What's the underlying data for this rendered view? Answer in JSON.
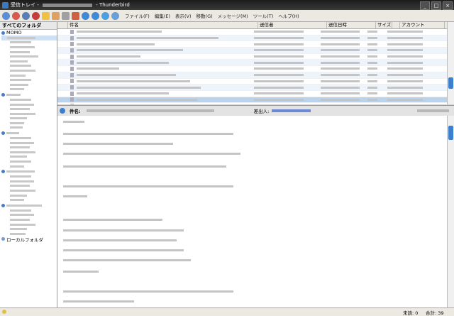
{
  "window": {
    "title_prefix": "受信トレイ - ",
    "title_suffix": " - Thunderbird",
    "minimize": "_",
    "maximize": "□",
    "close": "×"
  },
  "menu": [
    "ファイル(F)",
    "編集(E)",
    "表示(V)",
    "移動(G)",
    "メッセージ(M)",
    "ツール(T)",
    "ヘルプ(H)"
  ],
  "folders": {
    "header": "すべてのフォルダ",
    "first_account": "MOMO",
    "local": "ローカルフォルダ"
  },
  "columns": {
    "subject": "件名",
    "sender": "送信者",
    "date": "送信日時",
    "size": "サイズ",
    "account": "アカウント"
  },
  "message": {
    "subject_label": "件名:",
    "from_label": "差出人:"
  },
  "status": {
    "unread": "未読: 0",
    "total": "合計: 39"
  },
  "colors": {
    "accent": "#3c7fd0",
    "selection": "#b9d3ef"
  }
}
